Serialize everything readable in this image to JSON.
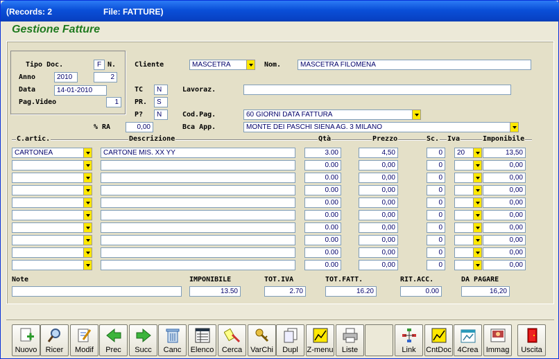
{
  "window": {
    "records": "(Records: 2",
    "file": "File: FATTURE)"
  },
  "app_title": "Gestione Fatture",
  "header": {
    "tipo_doc_label": "Tipo Doc.",
    "tipo_doc_value": "F",
    "n_label": "N.",
    "anno_label": "Anno",
    "anno_value": "2010",
    "n_value": "2",
    "data_label": "Data",
    "data_value": "14-01-2010",
    "pagvideo_label": "Pag.Video",
    "pagvideo_value": "1",
    "cliente_label": "Cliente",
    "cliente_value": "MASCETRA",
    "nom_label": "Nom.",
    "nom_value": "MASCETRA FILOMENA",
    "tc_label": "TC",
    "tc_value": "N",
    "lavoraz_label": "Lavoraz.",
    "lavoraz_value": "",
    "pr_label": "PR.",
    "pr_value": "S",
    "p_label": "P?",
    "p_value": "N",
    "codpag_label": "Cod.Pag.",
    "codpag_value": "60 GIORNI DATA FATTURA",
    "ra_label": "% RA",
    "ra_value": "0,00",
    "bcaapp_label": "Bca App.",
    "bcaapp_value": "MONTE DEI PASCHI SIENA  AG. 3  MILANO"
  },
  "columns": {
    "cartic": "C.artic.",
    "descrizione": "Descrizione",
    "qta": "Qtà",
    "prezzo": "Prezzo",
    "sc": "Sc.",
    "iva": "Iva",
    "imponibile": "Imponibile"
  },
  "rows": [
    {
      "cartic": "CARTONEA",
      "descr": "CARTONE MIS. XX YY",
      "qta": "3.00",
      "prezzo": "4,50",
      "sc": "0",
      "iva": "20",
      "imp": "13,50"
    },
    {
      "cartic": "",
      "descr": "",
      "qta": "0.00",
      "prezzo": "0,00",
      "sc": "0",
      "iva": "",
      "imp": "0,00"
    },
    {
      "cartic": "",
      "descr": "",
      "qta": "0.00",
      "prezzo": "0,00",
      "sc": "0",
      "iva": "",
      "imp": "0,00"
    },
    {
      "cartic": "",
      "descr": "",
      "qta": "0.00",
      "prezzo": "0,00",
      "sc": "0",
      "iva": "",
      "imp": "0,00"
    },
    {
      "cartic": "",
      "descr": "",
      "qta": "0.00",
      "prezzo": "0,00",
      "sc": "0",
      "iva": "",
      "imp": "0,00"
    },
    {
      "cartic": "",
      "descr": "",
      "qta": "0.00",
      "prezzo": "0,00",
      "sc": "0",
      "iva": "",
      "imp": "0,00"
    },
    {
      "cartic": "",
      "descr": "",
      "qta": "0.00",
      "prezzo": "0,00",
      "sc": "0",
      "iva": "",
      "imp": "0,00"
    },
    {
      "cartic": "",
      "descr": "",
      "qta": "0.00",
      "prezzo": "0,00",
      "sc": "0",
      "iva": "",
      "imp": "0,00"
    },
    {
      "cartic": "",
      "descr": "",
      "qta": "0.00",
      "prezzo": "0,00",
      "sc": "0",
      "iva": "",
      "imp": "0,00"
    },
    {
      "cartic": "",
      "descr": "",
      "qta": "0.00",
      "prezzo": "0,00",
      "sc": "0",
      "iva": "",
      "imp": "0,00"
    }
  ],
  "totals": {
    "note_label": "Note",
    "note_value": "",
    "imponibile_label": "IMPONIBILE",
    "imponibile_value": "13.50",
    "totiva_label": "TOT.IVA",
    "totiva_value": "2.70",
    "totfatt_label": "TOT.FATT.",
    "totfatt_value": "16.20",
    "ritacc_label": "RIT.ACC.",
    "ritacc_value": "0.00",
    "dapagare_label": "DA PAGARE",
    "dapagare_value": "16,20"
  },
  "toolbar": [
    {
      "label": "Nuovo",
      "icon": "new-doc-icon"
    },
    {
      "label": "Ricer",
      "icon": "magnifier-icon"
    },
    {
      "label": "Modif",
      "icon": "edit-doc-icon"
    },
    {
      "label": "Prec",
      "icon": "arrow-left-icon"
    },
    {
      "label": "Succ",
      "icon": "arrow-right-icon"
    },
    {
      "label": "Canc",
      "icon": "trash-icon"
    },
    {
      "label": "Elenco",
      "icon": "list-icon"
    },
    {
      "label": "Cerca",
      "icon": "search-tools-icon"
    },
    {
      "label": "VarChi",
      "icon": "keys-icon"
    },
    {
      "label": "Dupl",
      "icon": "duplicate-icon"
    },
    {
      "label": "Z-menu",
      "icon": "chart-board-icon"
    },
    {
      "label": "Liste",
      "icon": "printer-icon"
    },
    {
      "label": "",
      "icon": ""
    },
    {
      "label": "Link",
      "icon": "network-icon"
    },
    {
      "label": "CntDoc",
      "icon": "chart-board-icon"
    },
    {
      "label": "4Crea",
      "icon": "create-icon"
    },
    {
      "label": "Immag",
      "icon": "image-icon"
    },
    {
      "label": "Uscita",
      "icon": "exit-door-icon"
    }
  ],
  "colors": {
    "title_green": "#1F7A1F",
    "dropdown_yellow": "#FFE800",
    "field_text": "#00006A"
  }
}
